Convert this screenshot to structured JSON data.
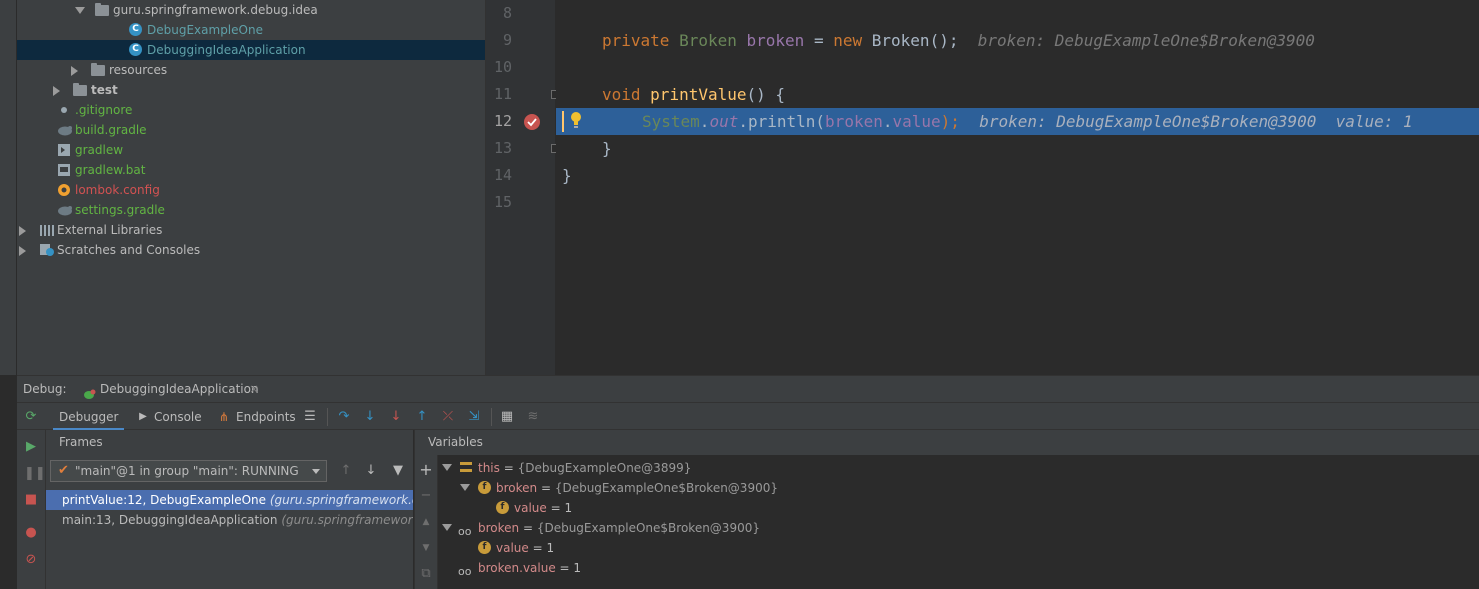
{
  "project_tree": {
    "items": [
      {
        "label": "guru.springframework.debug.idea",
        "style": "white",
        "indent": 78,
        "arrow": "down",
        "icon": "package-folder-icon"
      },
      {
        "label": "DebugExampleOne",
        "style": "teal",
        "indent": 112,
        "arrow": "",
        "icon": "class-icon"
      },
      {
        "label": "DebuggingIdeaApplication",
        "style": "teal",
        "indent": 112,
        "arrow": "",
        "icon": "class-icon",
        "selected": true
      },
      {
        "label": "resources",
        "style": "white",
        "indent": 74,
        "arrow": "right",
        "icon": "folder-icon"
      },
      {
        "label": "test",
        "style": "bold",
        "indent": 56,
        "arrow": "right",
        "icon": "folder-icon"
      },
      {
        "label": ".gitignore",
        "style": "green",
        "indent": 40,
        "arrow": "",
        "icon": "file-icon"
      },
      {
        "label": "build.gradle",
        "style": "green",
        "indent": 40,
        "arrow": "",
        "icon": "gradle-icon"
      },
      {
        "label": "gradlew",
        "style": "green",
        "indent": 40,
        "arrow": "",
        "icon": "script-icon"
      },
      {
        "label": "gradlew.bat",
        "style": "green",
        "indent": 40,
        "arrow": "",
        "icon": "bat-icon"
      },
      {
        "label": "lombok.config",
        "style": "red",
        "indent": 40,
        "arrow": "",
        "icon": "config-icon"
      },
      {
        "label": "settings.gradle",
        "style": "green",
        "indent": 40,
        "arrow": "",
        "icon": "gradle-icon"
      },
      {
        "label": "External Libraries",
        "style": "white",
        "indent": 22,
        "arrow": "right",
        "icon": "library-icon"
      },
      {
        "label": "Scratches and Consoles",
        "style": "white",
        "indent": 22,
        "arrow": "right",
        "icon": "scratches-icon"
      }
    ]
  },
  "editor": {
    "line_numbers": [
      "8",
      "9",
      "10",
      "11",
      "12",
      "13",
      "14",
      "15"
    ],
    "line9": {
      "kw": "private",
      "type": "Broken",
      "name": "broken",
      "eq": " = ",
      "new": "new",
      "ctor": "Broken();",
      "hint": "broken: DebugExampleOne$Broken@3900"
    },
    "line11": {
      "kw": "void",
      "method": "printValue",
      "rest": "() {"
    },
    "line12": {
      "sys": "System",
      "dot1": ".",
      "out": "out",
      "dot2": ".",
      "println": "println(",
      "arg": "broken",
      "dot3": ".",
      "field": "value",
      "close": ");",
      "hint": "broken: DebugExampleOne$Broken@3900  value: 1"
    },
    "line13": "}",
    "line14": "}"
  },
  "debug": {
    "label": "Debug:",
    "session_tab": "DebuggingIdeaApplication",
    "tabs": {
      "debugger": "Debugger",
      "console": "Console",
      "endpoints": "Endpoints"
    },
    "frames_header": "Frames",
    "variables_header": "Variables",
    "thread": "\"main\"@1 in group \"main\": RUNNING",
    "frames": [
      {
        "method": "printValue:12, DebugExampleOne",
        "pkg": "(guru.springframework.debug.id",
        "selected": true
      },
      {
        "method": "main:13, DebuggingIdeaApplication",
        "pkg": "(guru.springframework.debug",
        "selected": false
      }
    ],
    "variables": {
      "this": {
        "name": "this",
        "eq": " = ",
        "val": "{DebugExampleOne@3899}"
      },
      "this_broken": {
        "name": "broken",
        "eq": " = ",
        "val": "{DebugExampleOne$Broken@3900}"
      },
      "this_broken_value": {
        "name": "value",
        "eq": " = ",
        "val": "1"
      },
      "broken": {
        "name": "broken",
        "eq": " = ",
        "val": "{DebugExampleOne$Broken@3900}"
      },
      "broken_value": {
        "name": "value",
        "eq": " = ",
        "val": "1"
      },
      "broken_dot_value": {
        "name": "broken.value",
        "eq": " = ",
        "val": "1"
      }
    }
  },
  "colors": {
    "selection": "#0d293e",
    "exec_line": "#2d6099",
    "frame_selected": "#4b6eaf"
  }
}
